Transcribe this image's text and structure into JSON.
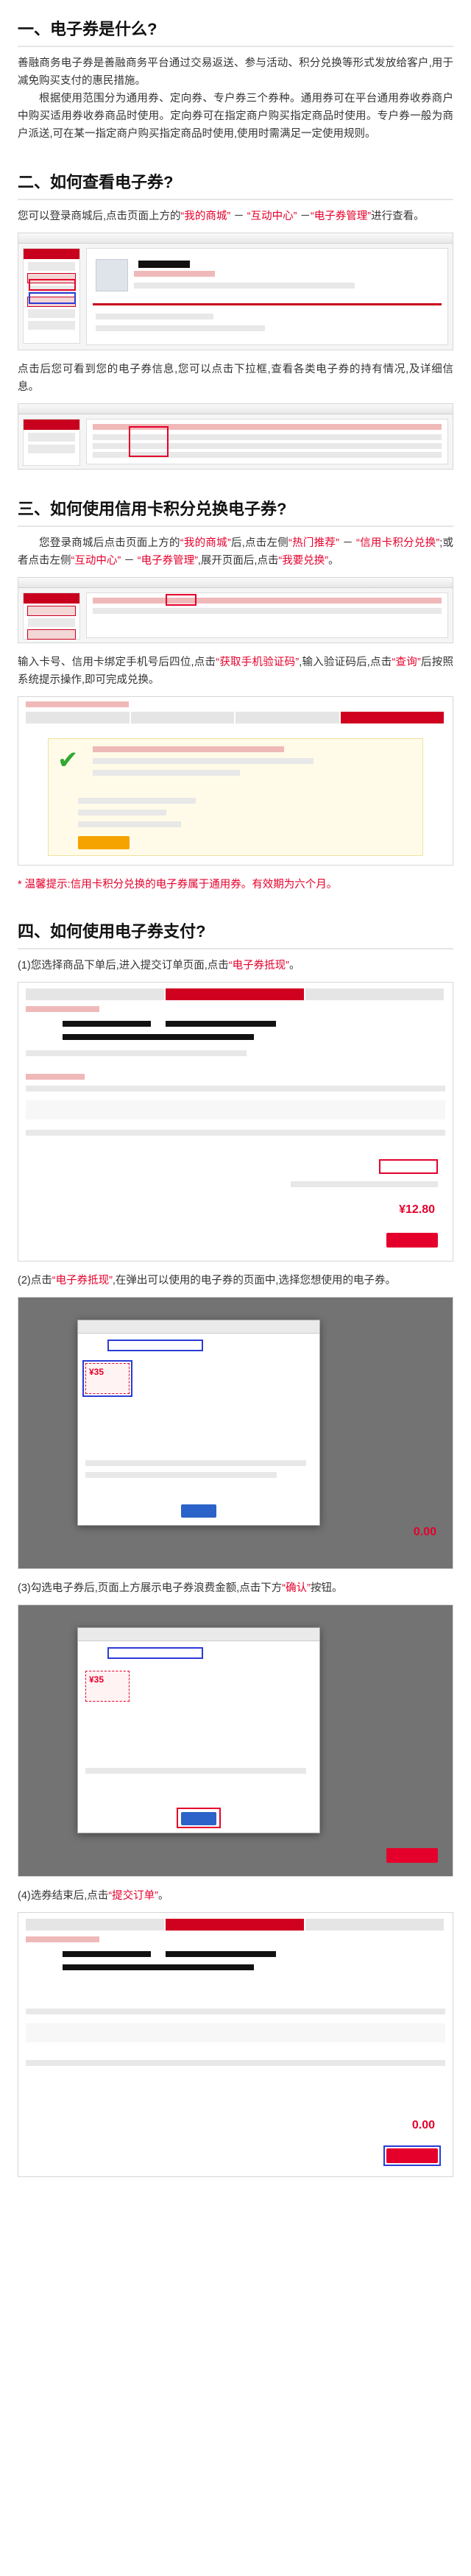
{
  "section1": {
    "title": "一、电子券是什么?",
    "para1": "善融商务电子券是善融商务平台通过交易返送、参与活动、积分兑换等形式发放给客户,用于减免购买支付的惠民措施。",
    "para2": "根据使用范围分为通用券、定向券、专户券三个券种。通用券可在平台通用券收券商户中购买适用券收券商品时使用。定向券可在指定商户购买指定商品时使用。专户券一般为商户派送,可在某一指定商户购买指定商品时使用,使用时需满足一定使用规则。"
  },
  "section2": {
    "title": "二、如何查看电子券?",
    "p1_a": "您可以登录商城后,点击页面上方的",
    "p1_b": "“我的商城”",
    "p1_c": " － ",
    "p1_d": "“互动中心”",
    "p1_e": " －",
    "p1_f": "“电子券管理”",
    "p1_g": "进行查看。",
    "p2": "点击后您可看到您的电子券信息,您可以点击下拉框,查看各类电子券的持有情况,及详细信息。"
  },
  "section3": {
    "title": "三、如何使用信用卡积分兑换电子券?",
    "p1_a": "您登录商城后点击页面上方的",
    "p1_b": "“我的商城”",
    "p1_c": "后,点击左侧",
    "p1_d": "“热门推荐”",
    "p1_e": " － ",
    "p1_f": "“信用卡积分兑换”",
    "p1_g": ";或者点击左侧",
    "p1_h": "“互动中心”",
    "p1_i": " － ",
    "p1_j": "“电子券管理”",
    "p1_k": ",展开页面后,点击",
    "p1_l": "“我要兑换”",
    "p1_m": "。",
    "p2_a": "输入卡号、信用卡绑定手机号后四位,点击",
    "p2_b": "“获取手机验证码”",
    "p2_c": ",输入验证码后,点击",
    "p2_d": "“查询”",
    "p2_e": "后按照系统提示操作,即可完成兑换。",
    "tip": "* 温馨提示:信用卡积分兑换的电子券属于通用券。有效期为六个月。"
  },
  "section4": {
    "title": "四、如何使用电子券支付?",
    "s1_a": "(1)您选择商品下单后,进入提交订单页面,点击",
    "s1_b": "“电子券抵现”",
    "s1_c": "。",
    "price1": "¥12.80",
    "s2_a": "(2)点击",
    "s2_b": "“电子券抵现”",
    "s2_c": ",在弹出可以使用的电子券的页面中,选择您想使用的电子券。",
    "coupon_amt": "¥35",
    "s3_a": "(3)勾选电子券后,页面上方展示电子券浪费金额,点击下方",
    "s3_b": "“确认”",
    "s3_c": "按钮。",
    "price_zero": "0.00",
    "s4_a": "(4)选券结束后,点击",
    "s4_b": "“提交订单”",
    "s4_c": "。"
  }
}
